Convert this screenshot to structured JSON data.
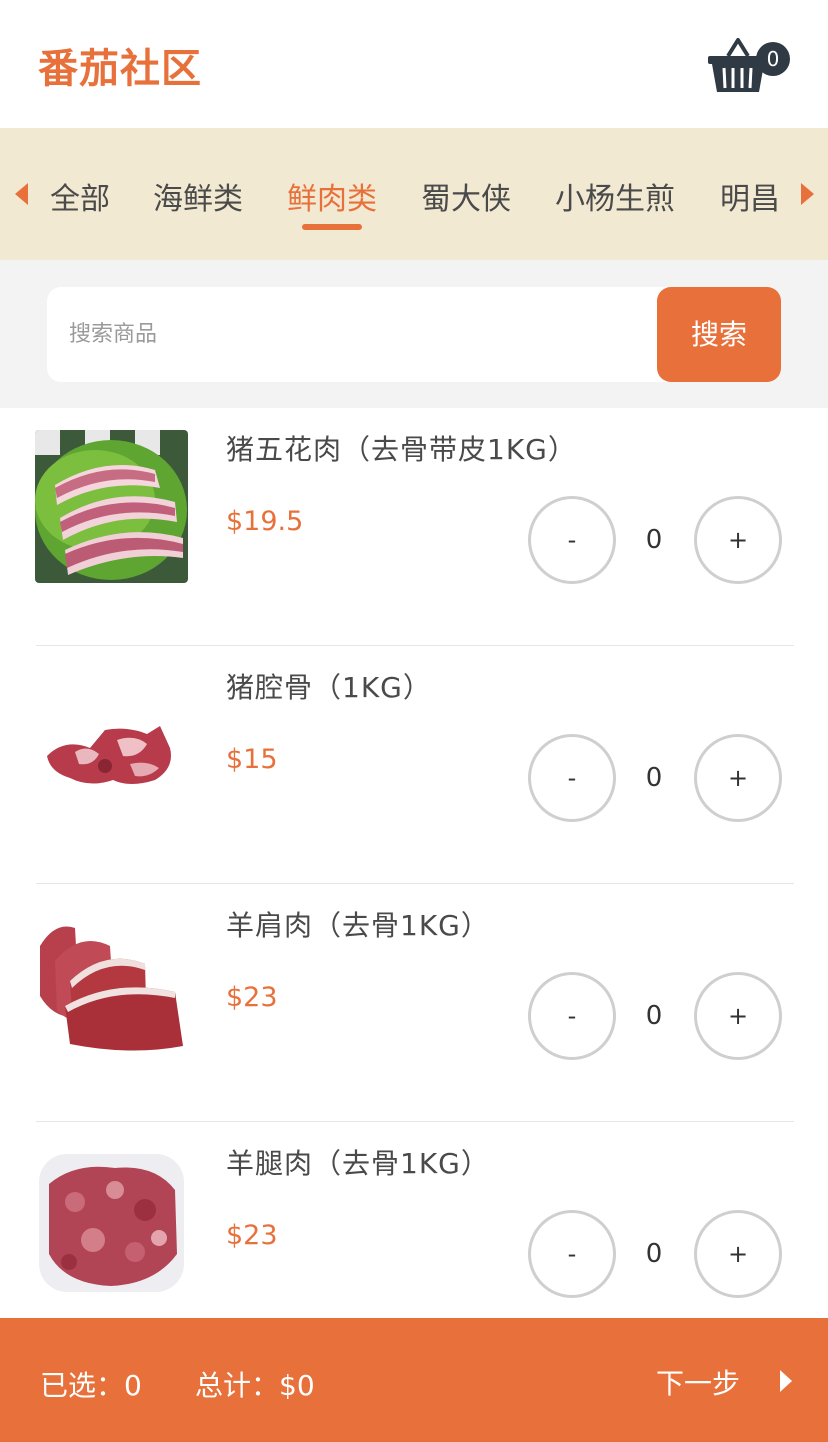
{
  "app": {
    "logo_text": "番茄社区",
    "brand_color": "#e8703a"
  },
  "cart": {
    "icon": "basket-icon",
    "count": "0"
  },
  "tabs": {
    "items": [
      {
        "label": "全部",
        "active": false
      },
      {
        "label": "海鲜类",
        "active": false
      },
      {
        "label": "鲜肉类",
        "active": true
      },
      {
        "label": "蜀大侠",
        "active": false
      },
      {
        "label": "小杨生煎",
        "active": false
      },
      {
        "label": "明昌",
        "active": false
      }
    ],
    "left_icon": "caret-left-icon",
    "right_icon": "caret-right-icon"
  },
  "search": {
    "placeholder": "搜索商品",
    "value": "",
    "button_label": "搜索"
  },
  "products": [
    {
      "name": "猪五花肉（去骨带皮1KG）",
      "price": "$19.5",
      "qty": "0",
      "minus": "-",
      "plus": "+"
    },
    {
      "name": "猪腔骨（1KG）",
      "price": "$15",
      "qty": "0",
      "minus": "-",
      "plus": "+"
    },
    {
      "name": "羊肩肉（去骨1KG）",
      "price": "$23",
      "qty": "0",
      "minus": "-",
      "plus": "+"
    },
    {
      "name": "羊腿肉（去骨1KG）",
      "price": "$23",
      "qty": "0",
      "minus": "-",
      "plus": "+"
    }
  ],
  "footer": {
    "selected_label": "已选：",
    "selected_value": "0",
    "total_label": "总计：",
    "total_value": "$0",
    "next_label": "下一步",
    "next_icon": "caret-right-icon"
  }
}
